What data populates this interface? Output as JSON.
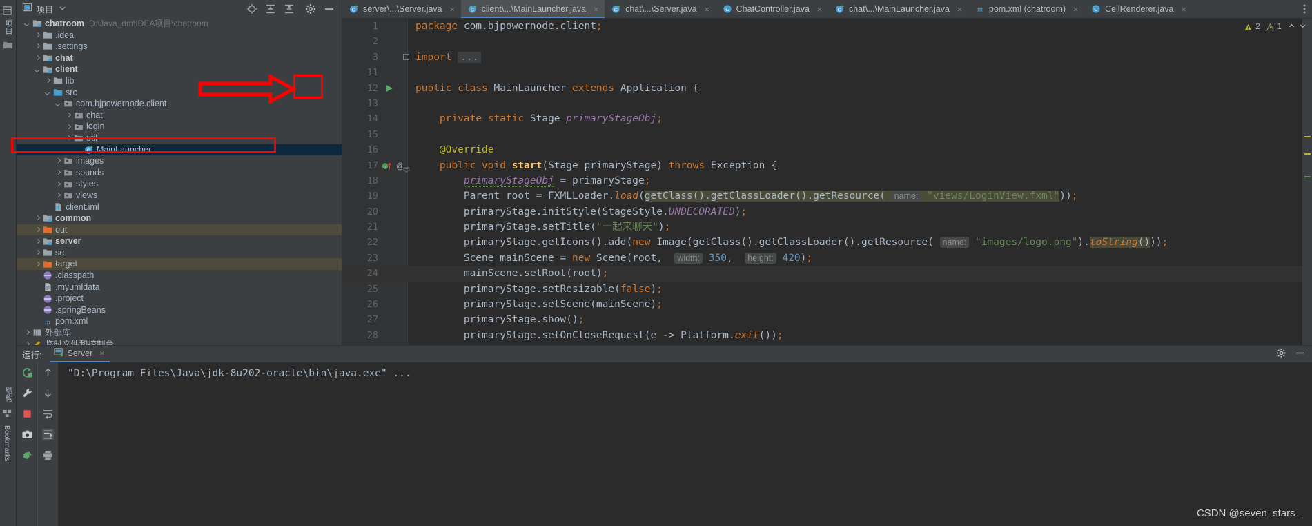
{
  "app": {
    "theme": "darcula",
    "accent": "#4a88c7",
    "watermark": "CSDN @seven_stars_"
  },
  "left_strip": {
    "tabs": [
      {
        "label": "项目",
        "name": "tool-window-project"
      },
      {
        "label": "结构",
        "name": "tool-window-structure"
      },
      {
        "label": "Bookmarks",
        "name": "tool-window-bookmarks"
      }
    ]
  },
  "project_panel": {
    "title": "项目",
    "dropdown_icon": "chevron-down-icon",
    "header_icons": [
      {
        "name": "locate-icon",
        "glyph": "target"
      },
      {
        "name": "expand-all-icon",
        "glyph": "expand"
      },
      {
        "name": "collapse-all-icon",
        "glyph": "collapse"
      },
      {
        "name": "settings-gear-icon",
        "glyph": "gear"
      },
      {
        "name": "hide-panel-icon",
        "glyph": "minus"
      }
    ],
    "tree": [
      {
        "label": "chatroom",
        "path": "D:\\Java_dm\\IDEA项目\\chatroom",
        "indent": 0,
        "arrow": "down",
        "icon": "module-folder",
        "bold": true
      },
      {
        "label": ".idea",
        "indent": 1,
        "arrow": "right",
        "icon": "folder"
      },
      {
        "label": ".settings",
        "indent": 1,
        "arrow": "right",
        "icon": "folder"
      },
      {
        "label": "chat",
        "indent": 1,
        "arrow": "right",
        "icon": "module-folder",
        "bold": true
      },
      {
        "label": "client",
        "indent": 1,
        "arrow": "down",
        "icon": "module-folder",
        "bold": true
      },
      {
        "label": "lib",
        "indent": 2,
        "arrow": "right",
        "icon": "folder"
      },
      {
        "label": "src",
        "indent": 2,
        "arrow": "down",
        "icon": "source-folder"
      },
      {
        "label": "com.bjpowernode.client",
        "indent": 3,
        "arrow": "down",
        "icon": "package"
      },
      {
        "label": "chat",
        "indent": 4,
        "arrow": "right",
        "icon": "package"
      },
      {
        "label": "login",
        "indent": 4,
        "arrow": "right",
        "icon": "package"
      },
      {
        "label": "util",
        "indent": 4,
        "arrow": "right",
        "icon": "package"
      },
      {
        "label": "MainLauncher",
        "indent": 5,
        "arrow": "none",
        "icon": "java-class-runnable",
        "selected": true
      },
      {
        "label": "images",
        "indent": 3,
        "arrow": "right",
        "icon": "package"
      },
      {
        "label": "sounds",
        "indent": 3,
        "arrow": "right",
        "icon": "package"
      },
      {
        "label": "styles",
        "indent": 3,
        "arrow": "right",
        "icon": "package"
      },
      {
        "label": "views",
        "indent": 3,
        "arrow": "right",
        "icon": "package"
      },
      {
        "label": "client.iml",
        "indent": 2,
        "arrow": "none",
        "icon": "iml-file"
      },
      {
        "label": "common",
        "indent": 1,
        "arrow": "right",
        "icon": "module-folder",
        "bold": true
      },
      {
        "label": "out",
        "indent": 1,
        "arrow": "right",
        "icon": "excluded-folder",
        "excluded": true
      },
      {
        "label": "server",
        "indent": 1,
        "arrow": "right",
        "icon": "module-folder",
        "bold": true
      },
      {
        "label": "src",
        "indent": 1,
        "arrow": "right",
        "icon": "folder"
      },
      {
        "label": "target",
        "indent": 1,
        "arrow": "right",
        "icon": "excluded-folder",
        "excluded": true
      },
      {
        "label": ".classpath",
        "indent": 1,
        "arrow": "none",
        "icon": "eclipse-file"
      },
      {
        "label": ".myumldata",
        "indent": 1,
        "arrow": "none",
        "icon": "text-file"
      },
      {
        "label": ".project",
        "indent": 1,
        "arrow": "none",
        "icon": "eclipse-file"
      },
      {
        "label": ".springBeans",
        "indent": 1,
        "arrow": "none",
        "icon": "eclipse-file"
      },
      {
        "label": "pom.xml",
        "indent": 1,
        "arrow": "none",
        "icon": "maven-file"
      },
      {
        "label": "外部库",
        "indent": 0,
        "arrow": "right",
        "icon": "library"
      },
      {
        "label": "临时文件和控制台",
        "indent": 0,
        "arrow": "right",
        "icon": "scratch"
      }
    ]
  },
  "editor_tabs": [
    {
      "label": "server\\...\\Server.java",
      "icon": "java-class-runnable",
      "active": false,
      "close": "×"
    },
    {
      "label": "client\\...\\MainLauncher.java",
      "icon": "java-class-runnable",
      "active": true,
      "close": "×"
    },
    {
      "label": "chat\\...\\Server.java",
      "icon": "java-class-runnable",
      "active": false,
      "close": "×"
    },
    {
      "label": "ChatController.java",
      "icon": "java-class",
      "active": false,
      "close": "×"
    },
    {
      "label": "chat\\...\\MainLauncher.java",
      "icon": "java-class-runnable",
      "active": false,
      "close": "×"
    },
    {
      "label": "pom.xml (chatroom)",
      "icon": "maven-file",
      "active": false,
      "close": "×"
    },
    {
      "label": "CellRenderer.java",
      "icon": "java-class",
      "active": false,
      "close": "×"
    }
  ],
  "tab_overflow_icon": "more-vertical-icon",
  "inspections": {
    "warnings_count": "2",
    "weak_warnings_count": "1",
    "up_icon": "chevron-up-icon",
    "down_icon": "chevron-down-icon"
  },
  "code": {
    "file": "MainLauncher.java",
    "lines": [
      {
        "n": "1",
        "text": "package com.bjpowernode.client;"
      },
      {
        "n": "2",
        "text": ""
      },
      {
        "n": "3",
        "text": "import ...",
        "folded": true
      },
      {
        "n": "11",
        "text": ""
      },
      {
        "n": "12",
        "text": "public class MainLauncher extends Application {",
        "gutter": "run-icon"
      },
      {
        "n": "13",
        "text": ""
      },
      {
        "n": "14",
        "text": "    private static Stage primaryStageObj;"
      },
      {
        "n": "15",
        "text": ""
      },
      {
        "n": "16",
        "text": "    @Override"
      },
      {
        "n": "17",
        "text": "    public void start(Stage primaryStage) throws Exception {",
        "gutter": "override-icon"
      },
      {
        "n": "18",
        "text": "        primaryStageObj = primaryStage;"
      },
      {
        "n": "19",
        "text": "        Parent root = FXMLLoader.load(getClass().getClassLoader().getResource( name: \"views/LoginView.fxml\"));"
      },
      {
        "n": "20",
        "text": "        primaryStage.initStyle(StageStyle.UNDECORATED);"
      },
      {
        "n": "21",
        "text": "        primaryStage.setTitle(\"一起来聊天\");"
      },
      {
        "n": "22",
        "text": "        primaryStage.getIcons().add(new Image(getClass().getClassLoader().getResource( name: \"images/logo.png\").toString()));"
      },
      {
        "n": "23",
        "text": "        Scene mainScene = new Scene(root,  width: 350,  height: 420);"
      },
      {
        "n": "24",
        "text": "        mainScene.setRoot(root);",
        "caret": true
      },
      {
        "n": "25",
        "text": "        primaryStage.setResizable(false);"
      },
      {
        "n": "26",
        "text": "        primaryStage.setScene(mainScene);"
      },
      {
        "n": "27",
        "text": "        primaryStage.show();"
      },
      {
        "n": "28",
        "text": "        primaryStage.setOnCloseRequest(e -> Platform.exit());"
      }
    ],
    "param_hints": {
      "name": "name:",
      "width": "width:",
      "height": "height:"
    },
    "literals": {
      "fxml_path": "views/LoginView.fxml",
      "logo_path": "images/logo.png",
      "window_title": "一起来聊天",
      "scene_width": "350",
      "scene_height": "420"
    }
  },
  "run_panel": {
    "label": "运行:",
    "tab_label": "Server",
    "tab_icon": "run-config-icon",
    "tab_close": "×",
    "console_text": "\"D:\\Program Files\\Java\\jdk-8u202-oracle\\bin\\java.exe\" ...",
    "left_tools": [
      {
        "name": "rerun-icon"
      },
      {
        "name": "wrench-settings-icon"
      },
      {
        "name": "stop-icon"
      },
      {
        "name": "camera-icon"
      },
      {
        "name": "debug-bug-icon"
      }
    ],
    "right_tools": [
      {
        "name": "scroll-up-icon"
      },
      {
        "name": "scroll-down-icon"
      },
      {
        "name": "soft-wrap-icon"
      },
      {
        "name": "scroll-to-end-icon",
        "selected": true
      },
      {
        "name": "print-icon"
      }
    ],
    "header_tools": [
      {
        "name": "settings-gear-icon"
      },
      {
        "name": "hide-panel-icon"
      }
    ]
  },
  "annotations": {
    "arrow": {
      "name": "red-arrow-annotation",
      "color": "#ff0000"
    },
    "box_gutter": {
      "name": "red-box-run-gutter",
      "color": "#ff0000"
    },
    "box_tree": {
      "name": "red-box-mainlauncher",
      "color": "#ff0000"
    }
  }
}
